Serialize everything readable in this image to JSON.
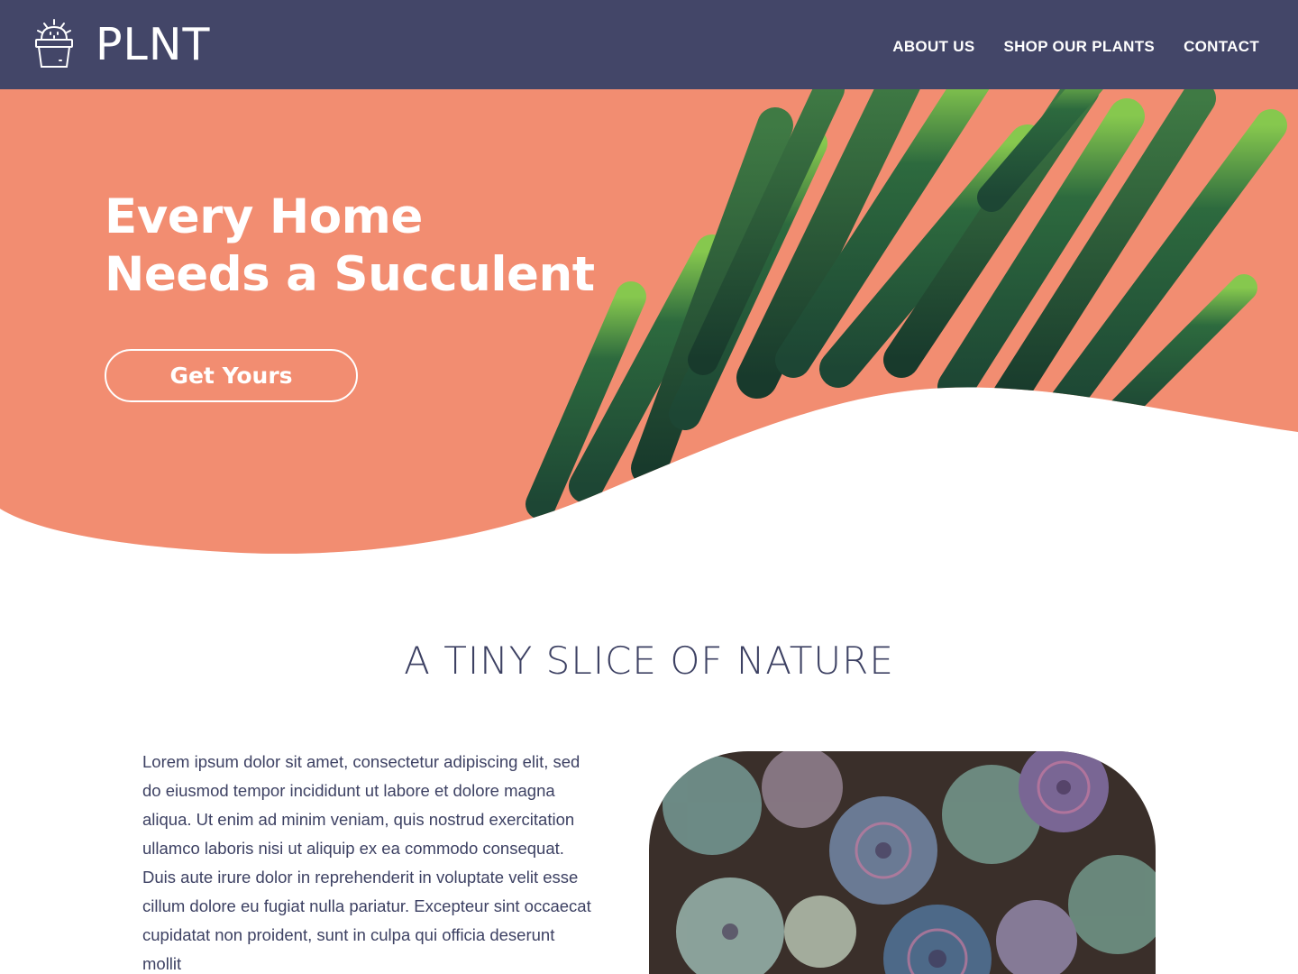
{
  "header": {
    "brand": "PLNT",
    "nav": [
      "ABOUT US",
      "SHOP OUR PLANTS",
      "CONTACT"
    ]
  },
  "hero": {
    "title_line1": "Every Home",
    "title_line2": "Needs a Succulent",
    "cta_label": "Get Yours"
  },
  "section": {
    "title": "A TINY SLICE OF NATURE",
    "body": "Lorem ipsum dolor sit amet, consectetur adipiscing elit, sed do eiusmod tempor incididunt ut labore et dolore magna aliqua. Ut enim ad minim veniam, quis nostrud exercitation ullamco laboris nisi ut aliquip ex ea commodo consequat. Duis aute irure dolor in reprehenderit in voluptate velit esse cillum dolore eu fugiat nulla pariatur. Excepteur sint occaecat cupidatat non proident, sunt in culpa qui officia deserunt mollit"
  },
  "colors": {
    "header_bg": "#434668",
    "hero_bg": "#f2886c",
    "text": "#3d4163",
    "plant_dark": "#1f4a36",
    "plant_light": "#7cc24a"
  },
  "icons": {
    "logo": "cactus-pot-icon"
  }
}
